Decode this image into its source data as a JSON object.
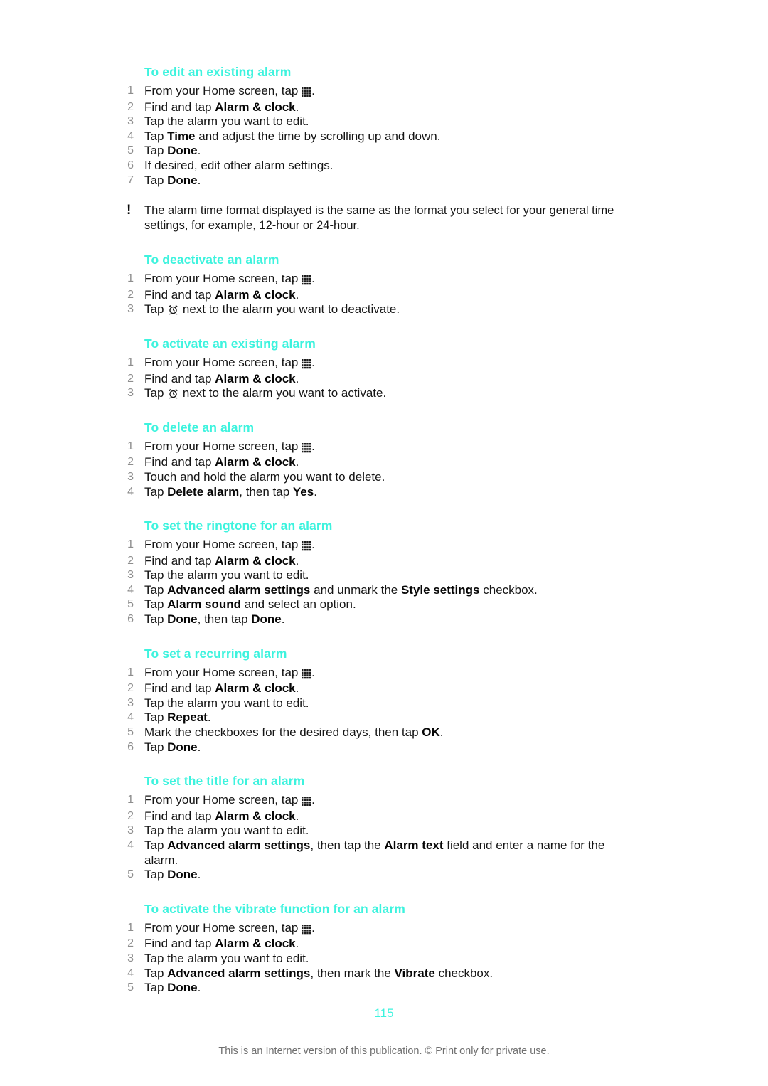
{
  "document": {
    "page_number": "115",
    "footer": "This is an Internet version of this publication. © Print only for private use.",
    "heading_color": "#3df3de",
    "step_number_color": "#8d8d8d",
    "body_color": "#151515"
  },
  "icons": {
    "app_grid": "app-grid-icon",
    "alarm_clock": "alarm-clock-icon",
    "note_marker": "!"
  },
  "sections": [
    {
      "id": "edit-existing-alarm",
      "heading": "To edit an existing alarm",
      "steps": [
        {
          "num": "1",
          "parts": [
            {
              "t": "From your Home screen, tap "
            },
            {
              "icon": "app-grid"
            },
            {
              "t": "."
            }
          ]
        },
        {
          "num": "2",
          "parts": [
            {
              "t": "Find and tap "
            },
            {
              "b": "Alarm & clock"
            },
            {
              "t": "."
            }
          ]
        },
        {
          "num": "3",
          "parts": [
            {
              "t": "Tap the alarm you want to edit."
            }
          ]
        },
        {
          "num": "4",
          "parts": [
            {
              "t": "Tap "
            },
            {
              "b": "Time"
            },
            {
              "t": " and adjust the time by scrolling up and down."
            }
          ]
        },
        {
          "num": "5",
          "parts": [
            {
              "t": "Tap "
            },
            {
              "b": "Done"
            },
            {
              "t": "."
            }
          ]
        },
        {
          "num": "6",
          "parts": [
            {
              "t": "If desired, edit other alarm settings."
            }
          ]
        },
        {
          "num": "7",
          "parts": [
            {
              "t": "Tap "
            },
            {
              "b": "Done"
            },
            {
              "t": "."
            }
          ]
        }
      ],
      "note": "The alarm time format displayed is the same as the format you select for your general time settings, for example, 12-hour or 24-hour."
    },
    {
      "id": "deactivate-an-alarm",
      "heading": "To deactivate an alarm",
      "steps": [
        {
          "num": "1",
          "parts": [
            {
              "t": "From your Home screen, tap "
            },
            {
              "icon": "app-grid"
            },
            {
              "t": "."
            }
          ]
        },
        {
          "num": "2",
          "parts": [
            {
              "t": "Find and tap "
            },
            {
              "b": "Alarm & clock"
            },
            {
              "t": "."
            }
          ]
        },
        {
          "num": "3",
          "parts": [
            {
              "t": "Tap "
            },
            {
              "icon": "alarm-clock"
            },
            {
              "t": " next to the alarm you want to deactivate."
            }
          ]
        }
      ]
    },
    {
      "id": "activate-existing-alarm",
      "heading": "To activate an existing alarm",
      "steps": [
        {
          "num": "1",
          "parts": [
            {
              "t": "From your Home screen, tap "
            },
            {
              "icon": "app-grid"
            },
            {
              "t": "."
            }
          ]
        },
        {
          "num": "2",
          "parts": [
            {
              "t": "Find and tap "
            },
            {
              "b": "Alarm & clock"
            },
            {
              "t": "."
            }
          ]
        },
        {
          "num": "3",
          "parts": [
            {
              "t": "Tap "
            },
            {
              "icon": "alarm-clock"
            },
            {
              "t": " next to the alarm you want to activate."
            }
          ]
        }
      ]
    },
    {
      "id": "delete-an-alarm",
      "heading": "To delete an alarm",
      "steps": [
        {
          "num": "1",
          "parts": [
            {
              "t": "From your Home screen, tap "
            },
            {
              "icon": "app-grid"
            },
            {
              "t": "."
            }
          ]
        },
        {
          "num": "2",
          "parts": [
            {
              "t": "Find and tap "
            },
            {
              "b": "Alarm & clock"
            },
            {
              "t": "."
            }
          ]
        },
        {
          "num": "3",
          "parts": [
            {
              "t": "Touch and hold the alarm you want to delete."
            }
          ]
        },
        {
          "num": "4",
          "parts": [
            {
              "t": "Tap "
            },
            {
              "b": "Delete alarm"
            },
            {
              "t": ", then tap "
            },
            {
              "b": "Yes"
            },
            {
              "t": "."
            }
          ]
        }
      ]
    },
    {
      "id": "set-ringtone-for-alarm",
      "heading": "To set the ringtone for an alarm",
      "steps": [
        {
          "num": "1",
          "parts": [
            {
              "t": "From your Home screen, tap "
            },
            {
              "icon": "app-grid"
            },
            {
              "t": "."
            }
          ]
        },
        {
          "num": "2",
          "parts": [
            {
              "t": "Find and tap "
            },
            {
              "b": "Alarm & clock"
            },
            {
              "t": "."
            }
          ]
        },
        {
          "num": "3",
          "parts": [
            {
              "t": "Tap the alarm you want to edit."
            }
          ]
        },
        {
          "num": "4",
          "parts": [
            {
              "t": "Tap "
            },
            {
              "b": "Advanced alarm settings"
            },
            {
              "t": " and unmark the "
            },
            {
              "b": "Style settings"
            },
            {
              "t": " checkbox."
            }
          ]
        },
        {
          "num": "5",
          "parts": [
            {
              "t": "Tap "
            },
            {
              "b": "Alarm sound"
            },
            {
              "t": " and select an option."
            }
          ]
        },
        {
          "num": "6",
          "parts": [
            {
              "t": "Tap "
            },
            {
              "b": "Done"
            },
            {
              "t": ", then tap "
            },
            {
              "b": "Done"
            },
            {
              "t": "."
            }
          ]
        }
      ]
    },
    {
      "id": "set-recurring-alarm",
      "heading": "To set a recurring alarm",
      "steps": [
        {
          "num": "1",
          "parts": [
            {
              "t": "From your Home screen, tap "
            },
            {
              "icon": "app-grid"
            },
            {
              "t": "."
            }
          ]
        },
        {
          "num": "2",
          "parts": [
            {
              "t": "Find and tap "
            },
            {
              "b": "Alarm & clock"
            },
            {
              "t": "."
            }
          ]
        },
        {
          "num": "3",
          "parts": [
            {
              "t": "Tap the alarm you want to edit."
            }
          ]
        },
        {
          "num": "4",
          "parts": [
            {
              "t": "Tap "
            },
            {
              "b": "Repeat"
            },
            {
              "t": "."
            }
          ]
        },
        {
          "num": "5",
          "parts": [
            {
              "t": "Mark the checkboxes for the desired days, then tap "
            },
            {
              "b": "OK"
            },
            {
              "t": "."
            }
          ]
        },
        {
          "num": "6",
          "parts": [
            {
              "t": "Tap "
            },
            {
              "b": "Done"
            },
            {
              "t": "."
            }
          ]
        }
      ]
    },
    {
      "id": "set-title-for-alarm",
      "heading": "To set the title for an alarm",
      "steps": [
        {
          "num": "1",
          "parts": [
            {
              "t": "From your Home screen, tap "
            },
            {
              "icon": "app-grid"
            },
            {
              "t": "."
            }
          ]
        },
        {
          "num": "2",
          "parts": [
            {
              "t": "Find and tap "
            },
            {
              "b": "Alarm & clock"
            },
            {
              "t": "."
            }
          ]
        },
        {
          "num": "3",
          "parts": [
            {
              "t": "Tap the alarm you want to edit."
            }
          ]
        },
        {
          "num": "4",
          "parts": [
            {
              "t": "Tap "
            },
            {
              "b": "Advanced alarm settings"
            },
            {
              "t": ", then tap the "
            },
            {
              "b": "Alarm text"
            },
            {
              "t": " field and enter a name for the alarm."
            }
          ]
        },
        {
          "num": "5",
          "parts": [
            {
              "t": "Tap "
            },
            {
              "b": "Done"
            },
            {
              "t": "."
            }
          ]
        }
      ]
    },
    {
      "id": "activate-vibrate-function",
      "heading": "To activate the vibrate function for an alarm",
      "steps": [
        {
          "num": "1",
          "parts": [
            {
              "t": "From your Home screen, tap "
            },
            {
              "icon": "app-grid"
            },
            {
              "t": "."
            }
          ]
        },
        {
          "num": "2",
          "parts": [
            {
              "t": "Find and tap "
            },
            {
              "b": "Alarm & clock"
            },
            {
              "t": "."
            }
          ]
        },
        {
          "num": "3",
          "parts": [
            {
              "t": "Tap the alarm you want to edit."
            }
          ]
        },
        {
          "num": "4",
          "parts": [
            {
              "t": "Tap "
            },
            {
              "b": "Advanced alarm settings"
            },
            {
              "t": ", then mark the "
            },
            {
              "b": "Vibrate"
            },
            {
              "t": " checkbox."
            }
          ]
        },
        {
          "num": "5",
          "parts": [
            {
              "t": "Tap "
            },
            {
              "b": "Done"
            },
            {
              "t": "."
            }
          ]
        }
      ]
    }
  ]
}
